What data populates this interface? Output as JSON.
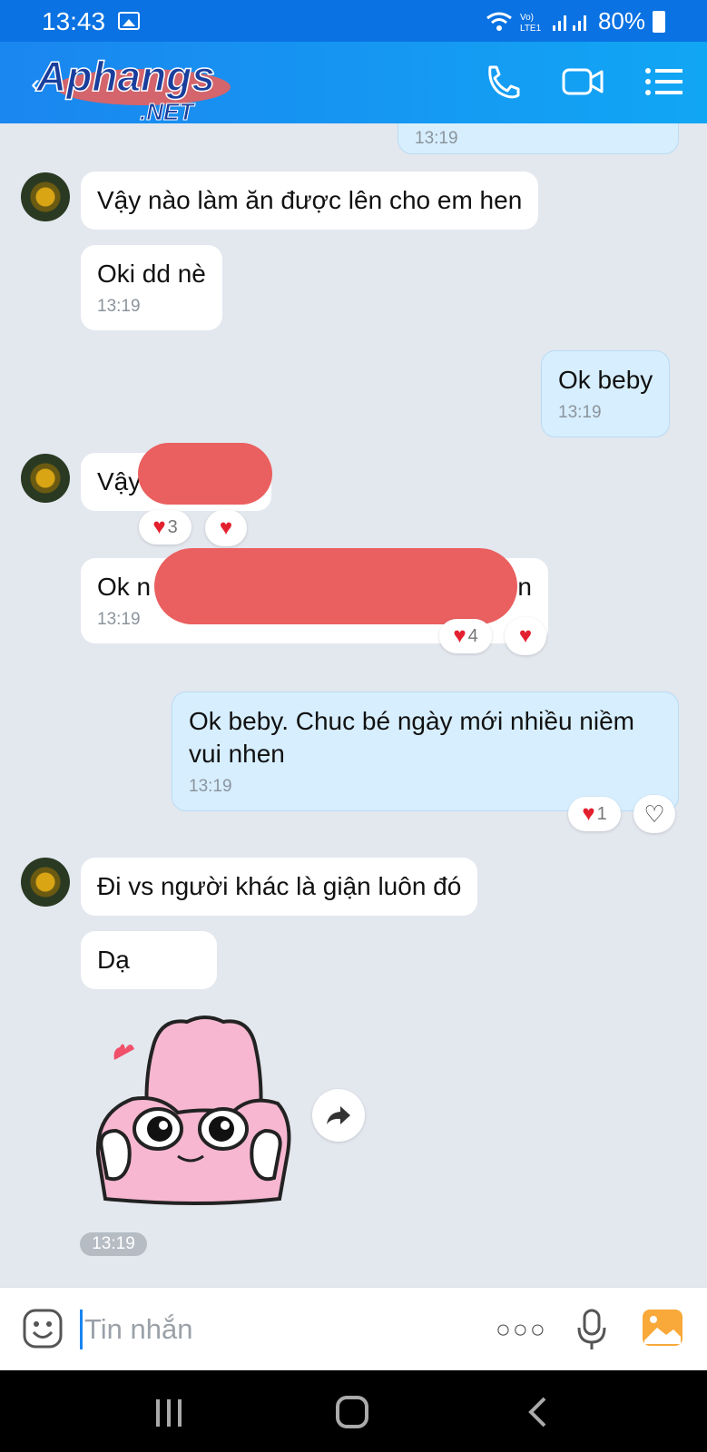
{
  "status_bar": {
    "time": "13:43",
    "battery": "80%",
    "icons": [
      "gallery-icon",
      "wifi-icon",
      "volte-icon",
      "signal-icon",
      "battery-icon"
    ]
  },
  "header": {
    "logo_text_main": "Aphangs",
    "logo_text_sub": ".NET",
    "icons": [
      "back-icon",
      "phone-icon",
      "video-call-icon",
      "menu-icon"
    ]
  },
  "messages": [
    {
      "time": "13:19"
    },
    {
      "text": "Vậy nào làm ăn được lên cho em hen"
    },
    {
      "text": "Oki dd nè",
      "time": "13:19"
    },
    {
      "text": "Ok beby",
      "time": "13:19"
    },
    {
      "text": "Vậy"
    },
    {
      "text_start": "Ok n",
      "text_end": "n",
      "time": "13:19"
    },
    {
      "text": "Ok beby. Chuc bé ngày mới nhiều niềm vui nhen",
      "time": "13:19"
    },
    {
      "text": "Đi vs người khác là giận luôn đó"
    },
    {
      "text": "Dạ"
    }
  ],
  "reactions": {
    "r1_count": "3",
    "r2_count": "4",
    "r3_count": "1"
  },
  "sticker": {
    "time": "13:19"
  },
  "input": {
    "placeholder": "Tin nhắn",
    "value": ""
  },
  "colors": {
    "header": "#1a86f0",
    "outgoing_bubble": "#d7eefe",
    "chat_bg": "#e3e7ee",
    "heart": "#e3202f"
  }
}
